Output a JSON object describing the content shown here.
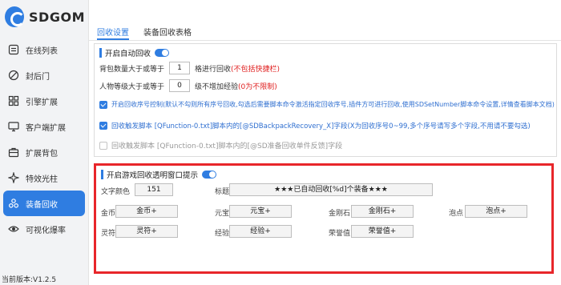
{
  "app": {
    "title": "SDGOM",
    "version": "当前版本:V1.2.5"
  },
  "sidebar": {
    "items": [
      {
        "label": "在线列表",
        "icon": "list-icon"
      },
      {
        "label": "封后门",
        "icon": "block-icon"
      },
      {
        "label": "引擎扩展",
        "icon": "grid-icon"
      },
      {
        "label": "客户端扩展",
        "icon": "monitor-icon"
      },
      {
        "label": "扩展背包",
        "icon": "bag-icon"
      },
      {
        "label": "特效光柱",
        "icon": "sparkle-icon"
      },
      {
        "label": "装备回收",
        "icon": "recycle-icon",
        "active": true
      },
      {
        "label": "可视化爆率",
        "icon": "eye-icon"
      }
    ]
  },
  "tabs": [
    {
      "label": "回收设置",
      "active": true
    },
    {
      "label": "装备回收表格",
      "active": false
    }
  ],
  "auto_recycle": {
    "title": "开启自动回收",
    "bag_row": {
      "prefix": "背包数量大于或等于",
      "value": "1",
      "suffix": "格进行回收",
      "note": "(不包括快捷栏)"
    },
    "level_row": {
      "prefix": "人物等级大于或等于",
      "value": "0",
      "suffix": "级不增加经验",
      "note": "(0为不限制)"
    },
    "option1": "开启回收序号控制(默认不勾则所有序号回收,勾选后需要脚本命令激活指定回收序号,插件方可进行回收,使用SDSetNumber脚本命令设置,详情查看脚本文档)",
    "option2": "回收触发脚本 [QFunction-0.txt]脚本内的[@SDBackpackRecovery_X]字段(X为回收序号0~99,多个序号请写多个字段,不用请不要勾选)",
    "option3": "回收触发脚本 [QFunction-0.txt]脚本内的[@SD准备回收单件反馈]字段"
  },
  "tip_window": {
    "title": "开启游戏回收透明窗口提示",
    "text_color_label": "文字颜色",
    "text_color_value": "151",
    "heading_label": "标题",
    "heading_value": "★★★已自动回收[%d]个装备★★★",
    "fields": [
      {
        "label": "金币",
        "value": "金币+"
      },
      {
        "label": "元宝",
        "value": "元宝+"
      },
      {
        "label": "金刚石",
        "value": "金刚石+"
      },
      {
        "label": "泡点",
        "value": "泡点+"
      },
      {
        "label": "灵符",
        "value": "灵符+"
      },
      {
        "label": "经验",
        "value": "经验+"
      },
      {
        "label": "荣誉值",
        "value": "荣誉值+"
      }
    ]
  },
  "colors": {
    "accent": "#2f7de1",
    "highlight_border": "#e8262a",
    "warning_text": "#e02020"
  }
}
